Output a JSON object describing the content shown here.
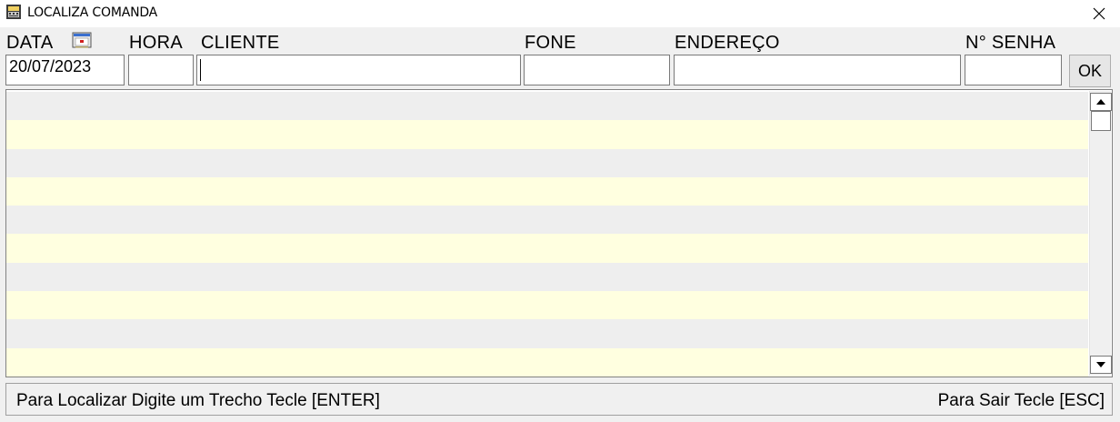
{
  "window": {
    "title": "LOCALIZA COMANDA",
    "app_icon": "cash-register-icon",
    "close_icon": "close-icon"
  },
  "form": {
    "labels": {
      "data": "DATA",
      "hora": "HORA",
      "cliente": "CLIENTE",
      "fone": "FONE",
      "endereco": "ENDEREÇO",
      "senha": "N° SENHA"
    },
    "values": {
      "data": "20/07/2023",
      "hora": "",
      "cliente": "",
      "fone": "",
      "endereco": "",
      "senha": ""
    },
    "calendar_icon": "calendar-icon",
    "ok_label": "OK"
  },
  "grid": {
    "rows": [
      "",
      "",
      "",
      "",
      "",
      "",
      "",
      "",
      "",
      ""
    ],
    "colors": {
      "even": "#eeeeee",
      "odd": "#ffffe0"
    }
  },
  "status": {
    "left": "Para Localizar Digite um Trecho Tecle [ENTER]",
    "right": "Para Sair Tecle [ESC]"
  }
}
